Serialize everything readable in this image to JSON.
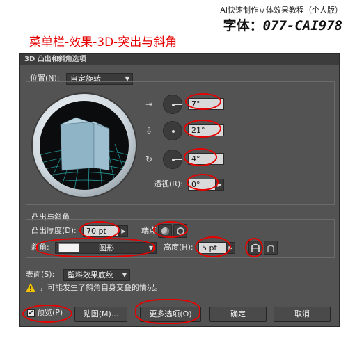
{
  "header": {
    "subtitle": "AI快速制作立体效果教程（个人版）",
    "font_prefix": "字体：",
    "font_code": "077-CAI978"
  },
  "annotation_title": "菜单栏-效果-3D-突出与斜角",
  "dialog": {
    "title": "3D 凸出和斜角选项",
    "position_label": "位置(N):",
    "position_value": "自定旋转",
    "rotation": {
      "x_angle": "7°",
      "y_angle": "21°",
      "z_angle": "4°",
      "x_icon": "⇥",
      "y_icon": "⇩",
      "z_icon": "↻"
    },
    "perspective_label": "透视(R):",
    "perspective_value": "0°",
    "extrude_section_label": "凸出与斜角",
    "extrude_depth_label": "凸出厚度(D):",
    "extrude_depth_value": "70 pt",
    "cap_label": "端点",
    "bevel_label": "斜角:",
    "bevel_value": "圆形",
    "height_label": "高度(H):",
    "height_value": "5 pt",
    "surface_label": "表面(S):",
    "surface_value": "塑料效果底纹",
    "warning_text": "，可能发生了斜角自身交叠的情况。",
    "buttons": {
      "preview": "预览(P)",
      "map_art": "贴图(M)...",
      "more_options": "更多选项(O)",
      "ok": "确定",
      "cancel": "取消"
    },
    "preview_checked": "✔"
  },
  "colors": {
    "annotation_red": "#e60000",
    "dialog_bg": "#535353",
    "cube_face": "#8fb4c6"
  }
}
